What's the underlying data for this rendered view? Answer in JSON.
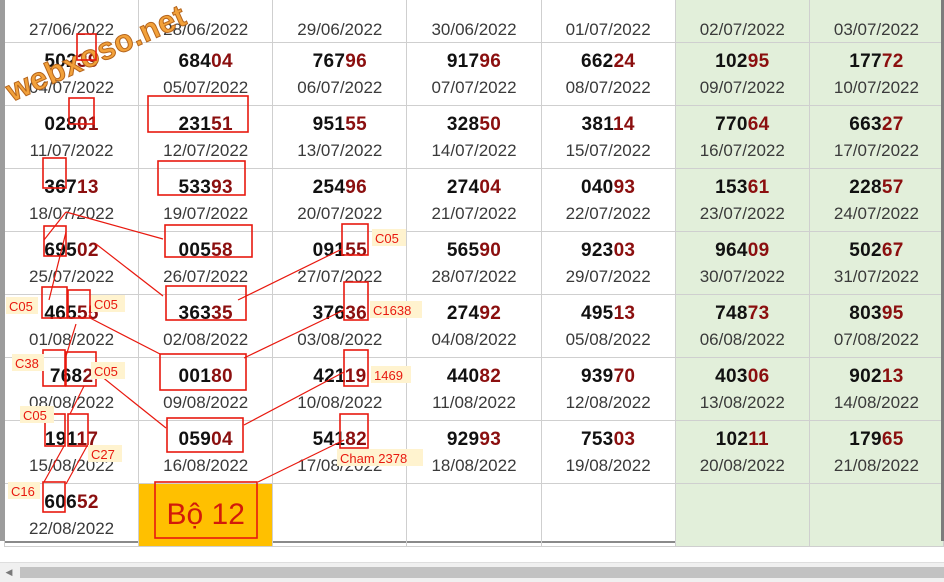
{
  "watermark": "webxoso.net",
  "rows": [
    [
      {
        "pre": "",
        "hi": "",
        "date": "27/06/2022"
      },
      {
        "pre": "",
        "hi": "",
        "date": "28/06/2022"
      },
      {
        "pre": "",
        "hi": "",
        "date": "29/06/2022"
      },
      {
        "pre": "",
        "hi": "",
        "date": "30/06/2022"
      },
      {
        "pre": "",
        "hi": "",
        "date": "01/07/2022"
      },
      {
        "pre": "",
        "hi": "",
        "date": "02/07/2022"
      },
      {
        "pre": "",
        "hi": "",
        "date": "03/07/2022"
      }
    ],
    [
      {
        "pre": "502",
        "hi": "39",
        "date": "04/07/2022"
      },
      {
        "pre": "684",
        "hi": "04",
        "date": "05/07/2022"
      },
      {
        "pre": "767",
        "hi": "96",
        "date": "06/07/2022"
      },
      {
        "pre": "917",
        "hi": "96",
        "date": "07/07/2022"
      },
      {
        "pre": "662",
        "hi": "24",
        "date": "08/07/2022"
      },
      {
        "pre": "102",
        "hi": "95",
        "date": "09/07/2022"
      },
      {
        "pre": "177",
        "hi": "72",
        "date": "10/07/2022"
      }
    ],
    [
      {
        "pre": "028",
        "hi": "01",
        "date": "11/07/2022"
      },
      {
        "pre": "231",
        "hi": "51",
        "date": "12/07/2022"
      },
      {
        "pre": "951",
        "hi": "55",
        "date": "13/07/2022"
      },
      {
        "pre": "328",
        "hi": "50",
        "date": "14/07/2022"
      },
      {
        "pre": "381",
        "hi": "14",
        "date": "15/07/2022"
      },
      {
        "pre": "770",
        "hi": "64",
        "date": "16/07/2022"
      },
      {
        "pre": "663",
        "hi": "27",
        "date": "17/07/2022"
      }
    ],
    [
      {
        "pre": "367",
        "hi": "13",
        "date": "18/07/2022"
      },
      {
        "pre": "533",
        "hi": "93",
        "date": "19/07/2022"
      },
      {
        "pre": "254",
        "hi": "96",
        "date": "20/07/2022"
      },
      {
        "pre": "274",
        "hi": "04",
        "date": "21/07/2022"
      },
      {
        "pre": "040",
        "hi": "93",
        "date": "22/07/2022"
      },
      {
        "pre": "153",
        "hi": "61",
        "date": "23/07/2022"
      },
      {
        "pre": "228",
        "hi": "57",
        "date": "24/07/2022"
      }
    ],
    [
      {
        "pre": "695",
        "hi": "02",
        "date": "25/07/2022"
      },
      {
        "pre": "005",
        "hi": "58",
        "date": "26/07/2022"
      },
      {
        "pre": "091",
        "hi": "55",
        "date": "27/07/2022"
      },
      {
        "pre": "565",
        "hi": "90",
        "date": "28/07/2022"
      },
      {
        "pre": "923",
        "hi": "03",
        "date": "29/07/2022"
      },
      {
        "pre": "964",
        "hi": "09",
        "date": "30/07/2022"
      },
      {
        "pre": "502",
        "hi": "67",
        "date": "31/07/2022"
      }
    ],
    [
      {
        "pre": "465",
        "hi": "55",
        "date": "01/08/2022"
      },
      {
        "pre": "363",
        "hi": "35",
        "date": "02/08/2022"
      },
      {
        "pre": "376",
        "hi": "36",
        "date": "03/08/2022"
      },
      {
        "pre": "274",
        "hi": "92",
        "date": "04/08/2022"
      },
      {
        "pre": "495",
        "hi": "13",
        "date": "05/08/2022"
      },
      {
        "pre": "748",
        "hi": "73",
        "date": "06/08/2022"
      },
      {
        "pre": "803",
        "hi": "95",
        "date": "07/08/2022"
      }
    ],
    [
      {
        "pre": "768",
        "hi": "2",
        "date": "08/08/2022"
      },
      {
        "pre": "001",
        "hi": "80",
        "date": "09/08/2022"
      },
      {
        "pre": "421",
        "hi": "19",
        "date": "10/08/2022"
      },
      {
        "pre": "440",
        "hi": "82",
        "date": "11/08/2022"
      },
      {
        "pre": "939",
        "hi": "70",
        "date": "12/08/2022"
      },
      {
        "pre": "403",
        "hi": "06",
        "date": "13/08/2022"
      },
      {
        "pre": "902",
        "hi": "13",
        "date": "14/08/2022"
      }
    ],
    [
      {
        "pre": "191",
        "hi": "17",
        "date": "15/08/2022"
      },
      {
        "pre": "059",
        "hi": "04",
        "date": "16/08/2022"
      },
      {
        "pre": "541",
        "hi": "82",
        "date": "17/08/2022"
      },
      {
        "pre": "929",
        "hi": "93",
        "date": "18/08/2022"
      },
      {
        "pre": "753",
        "hi": "03",
        "date": "19/08/2022"
      },
      {
        "pre": "102",
        "hi": "11",
        "date": "20/08/2022"
      },
      {
        "pre": "179",
        "hi": "65",
        "date": "21/08/2022"
      }
    ],
    [
      {
        "pre": "606",
        "hi": "52",
        "date": "22/08/2022"
      },
      {
        "pre": "",
        "hi": "",
        "date": "",
        "label": "Bộ 12"
      },
      {
        "pre": "",
        "hi": "",
        "date": ""
      },
      {
        "pre": "",
        "hi": "",
        "date": ""
      },
      {
        "pre": "",
        "hi": "",
        "date": ""
      },
      {
        "pre": "",
        "hi": "",
        "date": ""
      },
      {
        "pre": "",
        "hi": "",
        "date": ""
      }
    ]
  ],
  "annotations": {
    "c05_a": "C05",
    "c05_b": "C05",
    "c05_c": "C05",
    "c05_d": "C05",
    "c05_e": "C05",
    "c1638": "C1638",
    "c38": "C38",
    "l1469": "1469",
    "c27": "C27",
    "c16": "C16",
    "cham": "Cham 2378"
  },
  "colors": {
    "weekend_bg": "#e2efda",
    "highlight_digits": "#8b0f0f",
    "annotation_red": "#e8190f",
    "bo12_bg": "#ffc000",
    "annotation_label_bg": "#fff3cf"
  }
}
